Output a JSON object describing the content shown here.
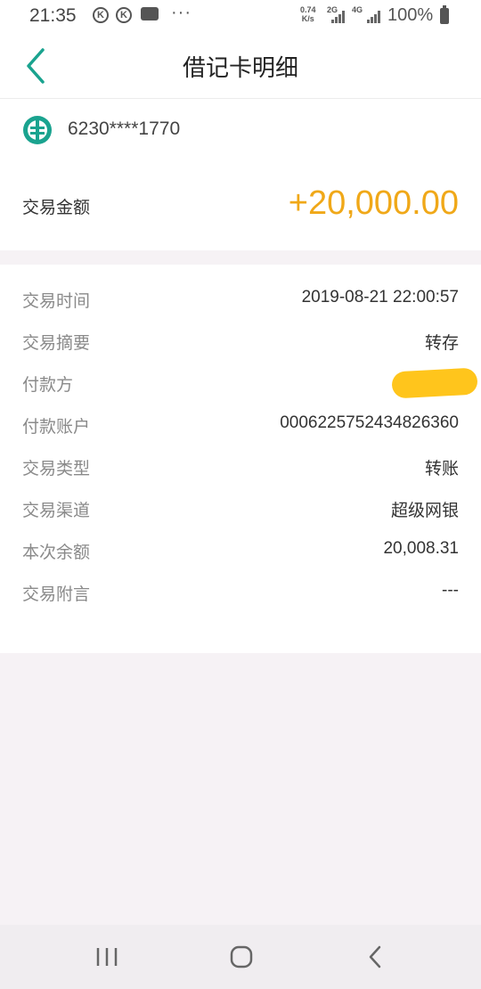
{
  "status_bar": {
    "time": "21:35",
    "k_icon_letter": "K",
    "dots": "···",
    "speed_top": "0.74",
    "speed_bottom": "K/s",
    "net1": "2G",
    "net2": "4G",
    "battery": "100%"
  },
  "header": {
    "title": "借记卡明细"
  },
  "card": {
    "number": "6230****1770",
    "amount_label": "交易金额",
    "amount_value": "+20,000.00"
  },
  "details": [
    {
      "label": "交易时间",
      "value": "2019-08-21 22:00:57"
    },
    {
      "label": "交易摘要",
      "value": "转存"
    },
    {
      "label": "付款方",
      "value": ""
    },
    {
      "label": "付款账户",
      "value": "0006225752434826360"
    },
    {
      "label": "交易类型",
      "value": "转账"
    },
    {
      "label": "交易渠道",
      "value": "超级网银"
    },
    {
      "label": "本次余额",
      "value": "20,008.31"
    },
    {
      "label": "交易附言",
      "value": "---"
    }
  ],
  "colors": {
    "accent": "#1aa38f",
    "amount": "#f0a818",
    "redaction": "#ffc51c"
  }
}
